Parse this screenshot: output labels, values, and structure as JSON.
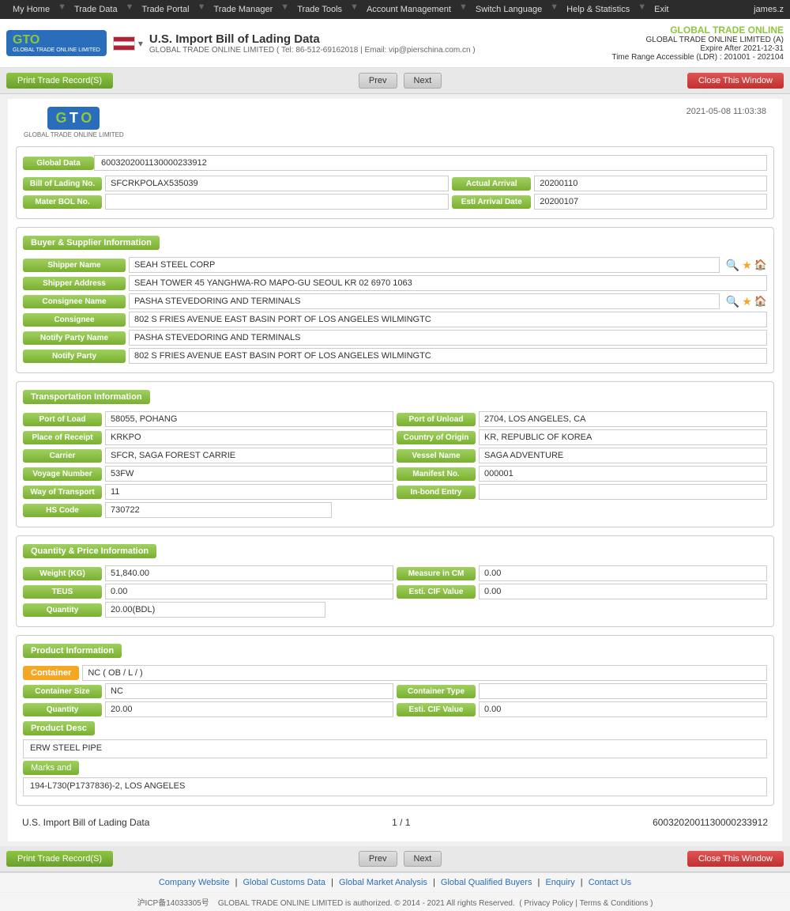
{
  "topnav": {
    "items": [
      "My Home",
      "Trade Data",
      "Trade Portal",
      "Trade Manager",
      "Trade Tools",
      "Account Management",
      "Switch Language",
      "Help & Statistics",
      "Exit"
    ],
    "user": "james.z"
  },
  "header": {
    "title": "U.S. Import Bill of Lading Data",
    "subtitle": "GLOBAL TRADE ONLINE LIMITED ( Tel: 86-512-69162018 | Email: vip@pierschina.com.cn )",
    "company_name": "GLOBAL TRADE ONLINE",
    "company_full": "GLOBAL TRADE ONLINE LIMITED (A)",
    "expire": "Expire After 2021-12-31",
    "time_range": "Time Range Accessible (LDR) : 201001 - 202104"
  },
  "toolbar": {
    "print_label": "Print Trade Record(S)",
    "prev_label": "Prev",
    "next_label": "Next",
    "close_label": "Close This Window"
  },
  "record": {
    "datetime": "2021-05-08 11:03:38",
    "global_data_label": "Global Data",
    "global_data_value": "6003202001130000233912",
    "bol_label": "Bill of Lading No.",
    "bol_value": "SFCRKPOLAX535039",
    "actual_arrival_label": "Actual Arrival",
    "actual_arrival_value": "20200110",
    "master_bol_label": "Mater BOL No.",
    "master_bol_value": "",
    "esti_arrival_label": "Esti Arrival Date",
    "esti_arrival_value": "20200107"
  },
  "buyer_supplier": {
    "section_label": "Buyer & Supplier Information",
    "shipper_name_label": "Shipper Name",
    "shipper_name_value": "SEAH STEEL CORP",
    "shipper_address_label": "Shipper Address",
    "shipper_address_value": "SEAH TOWER 45 YANGHWA-RO MAPO-GU SEOUL KR 02 6970 1063",
    "consignee_name_label": "Consignee Name",
    "consignee_name_value": "PASHA STEVEDORING AND TERMINALS",
    "consignee_label": "Consignee",
    "consignee_value": "802 S FRIES AVENUE EAST BASIN PORT OF LOS ANGELES WILMINGTC",
    "notify_party_name_label": "Notify Party Name",
    "notify_party_name_value": "PASHA STEVEDORING AND TERMINALS",
    "notify_party_label": "Notify Party",
    "notify_party_value": "802 S FRIES AVENUE EAST BASIN PORT OF LOS ANGELES WILMINGTC"
  },
  "transportation": {
    "section_label": "Transportation Information",
    "port_of_load_label": "Port of Load",
    "port_of_load_value": "58055, POHANG",
    "port_of_unload_label": "Port of Unload",
    "port_of_unload_value": "2704, LOS ANGELES, CA",
    "place_of_receipt_label": "Place of Receipt",
    "place_of_receipt_value": "KRKPO",
    "country_of_origin_label": "Country of Origin",
    "country_of_origin_value": "KR, REPUBLIC OF KOREA",
    "carrier_label": "Carrier",
    "carrier_value": "SFCR, SAGA FOREST CARRIE",
    "vessel_name_label": "Vessel Name",
    "vessel_name_value": "SAGA ADVENTURE",
    "voyage_number_label": "Voyage Number",
    "voyage_number_value": "53FW",
    "manifest_no_label": "Manifest No.",
    "manifest_no_value": "000001",
    "way_of_transport_label": "Way of Transport",
    "way_of_transport_value": "11",
    "in_bond_entry_label": "In-bond Entry",
    "in_bond_entry_value": "",
    "hs_code_label": "HS Code",
    "hs_code_value": "730722"
  },
  "quantity_price": {
    "section_label": "Quantity & Price Information",
    "weight_label": "Weight (KG)",
    "weight_value": "51,840.00",
    "measure_label": "Measure in CM",
    "measure_value": "0.00",
    "teus_label": "TEUS",
    "teus_value": "0.00",
    "esti_cif_label": "Esti. CIF Value",
    "esti_cif_value": "0.00",
    "quantity_label": "Quantity",
    "quantity_value": "20.00(BDL)"
  },
  "product": {
    "section_label": "Product Information",
    "container_btn_label": "Container",
    "container_value": "NC ( OB / L / )",
    "container_size_label": "Container Size",
    "container_size_value": "NC",
    "container_type_label": "Container Type",
    "container_type_value": "",
    "quantity_label": "Quantity",
    "quantity_value": "20.00",
    "esti_cif_label": "Esti. CIF Value",
    "esti_cif_value": "0.00",
    "product_desc_label": "Product Desc",
    "product_desc_value": "ERW STEEL PIPE",
    "marks_btn_label": "Marks and",
    "marks_value": "194-L730(P1737836)-2, LOS ANGELES"
  },
  "record_footer": {
    "page_label": "U.S. Import Bill of Lading Data",
    "page_num": "1 / 1",
    "record_id": "6003202001130000233912"
  },
  "footer": {
    "links": [
      "Company Website",
      "Global Customs Data",
      "Global Market Analysis",
      "Global Qualified Buyers",
      "Enquiry",
      "Contact Us"
    ],
    "copyright": "GLOBAL TRADE ONLINE LIMITED is authorized. © 2014 - 2021 All rights Reserved.",
    "privacy": "Privacy Policy",
    "terms": "Terms & Conditions",
    "icp": "沪ICP备14033305号"
  }
}
